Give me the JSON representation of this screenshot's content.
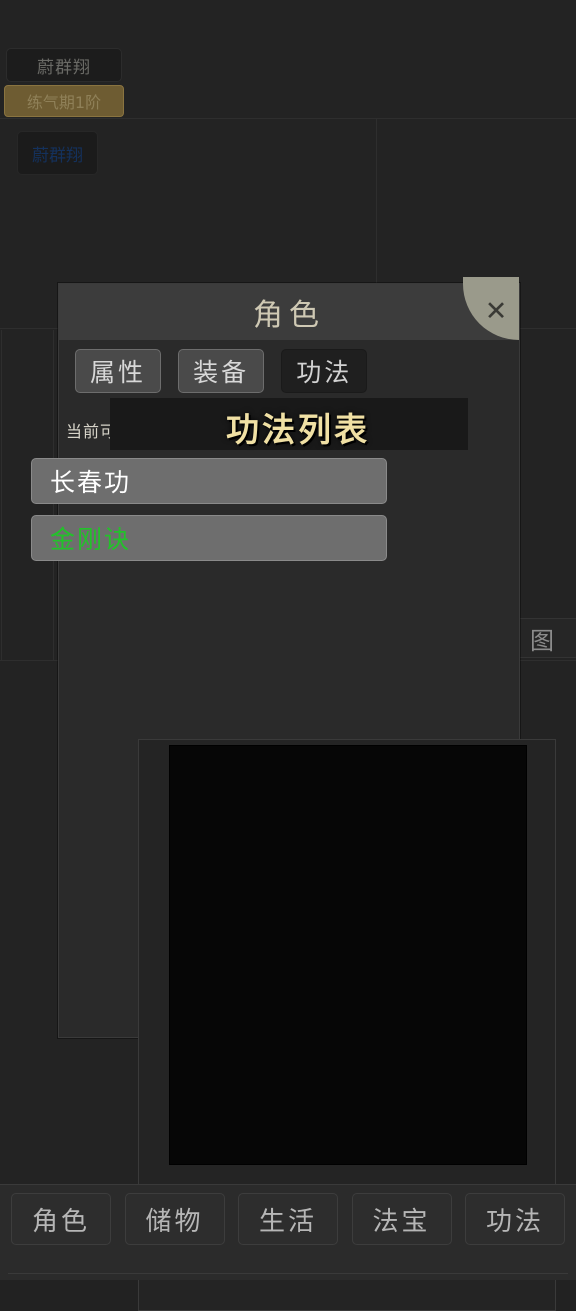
{
  "background": {
    "player_name": "蔚群翔",
    "realm": "练气期1阶",
    "blue_label": "蔚群翔",
    "map_label": "图"
  },
  "dialog": {
    "title": "角色",
    "close_icon": "close-icon",
    "close_glyph": "✕",
    "tabs": [
      {
        "label": "属性",
        "active": false
      },
      {
        "label": "装备",
        "active": false
      },
      {
        "label": "功法",
        "active": true
      }
    ],
    "count_label": "当前可穿戴功法数量：",
    "overlay_title": "功法列表",
    "items": [
      {
        "name": "长春功",
        "color": "#ffffff"
      },
      {
        "name": "金刚诀",
        "color": "#22c22a"
      }
    ]
  },
  "bottom_nav": {
    "items": [
      {
        "label": "角色"
      },
      {
        "label": "储物"
      },
      {
        "label": "生活"
      },
      {
        "label": "法宝"
      },
      {
        "label": "功法"
      }
    ]
  },
  "colors": {
    "accent_gold": "#f0e0a4",
    "realm_bg": "#6e5c32",
    "item_bg": "#6e6e6e",
    "dialog_bg": "#2a2a2a",
    "highlight_green": "#22c22a"
  }
}
